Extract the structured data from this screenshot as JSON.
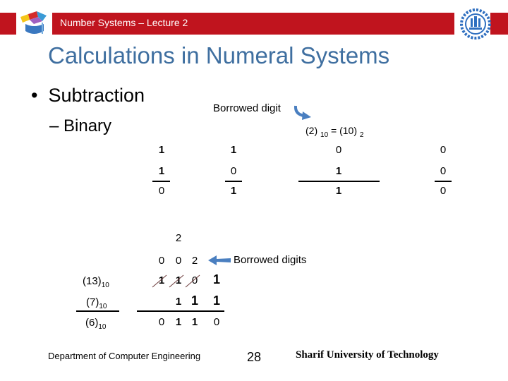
{
  "header": {
    "title": "Number Systems – Lecture 2",
    "bar_color": "#c0141e"
  },
  "slide": {
    "title": "Calculations in Numeral Systems",
    "title_color": "#3f6fa0",
    "bullet": "Subtraction",
    "sub_bullet": "– Binary"
  },
  "column_example": {
    "annotation": "Borrowed digit",
    "equation": {
      "left": "(2)",
      "left_base": "10",
      "eq": "=",
      "right": "(10)",
      "right_base": "2"
    },
    "columns": [
      {
        "minuend": "1",
        "subtrahend": "1",
        "result": "0"
      },
      {
        "minuend": "1",
        "subtrahend": "0",
        "result": "1"
      },
      {
        "minuend": "0",
        "subtrahend": "1",
        "result": "1"
      },
      {
        "minuend": "0",
        "subtrahend": "0",
        "result": "0"
      }
    ]
  },
  "full_example": {
    "top_borrow": "2",
    "borrow_row": [
      "0",
      "0",
      "2"
    ],
    "borrow_annotation": "Borrowed digits",
    "minuend_digits": [
      "1",
      "1",
      "0",
      "1"
    ],
    "subtrahend_digits": [
      "1",
      "1",
      "1"
    ],
    "result_digits": [
      "0",
      "1",
      "1",
      "0"
    ],
    "labels": [
      {
        "value": "(13)",
        "base": "10"
      },
      {
        "value": "(7)",
        "base": "10"
      },
      {
        "value": "(6)",
        "base": "10"
      }
    ]
  },
  "footer": {
    "department": "Department of Computer Engineering",
    "page_number": "28",
    "university": "Sharif University of Technology"
  }
}
